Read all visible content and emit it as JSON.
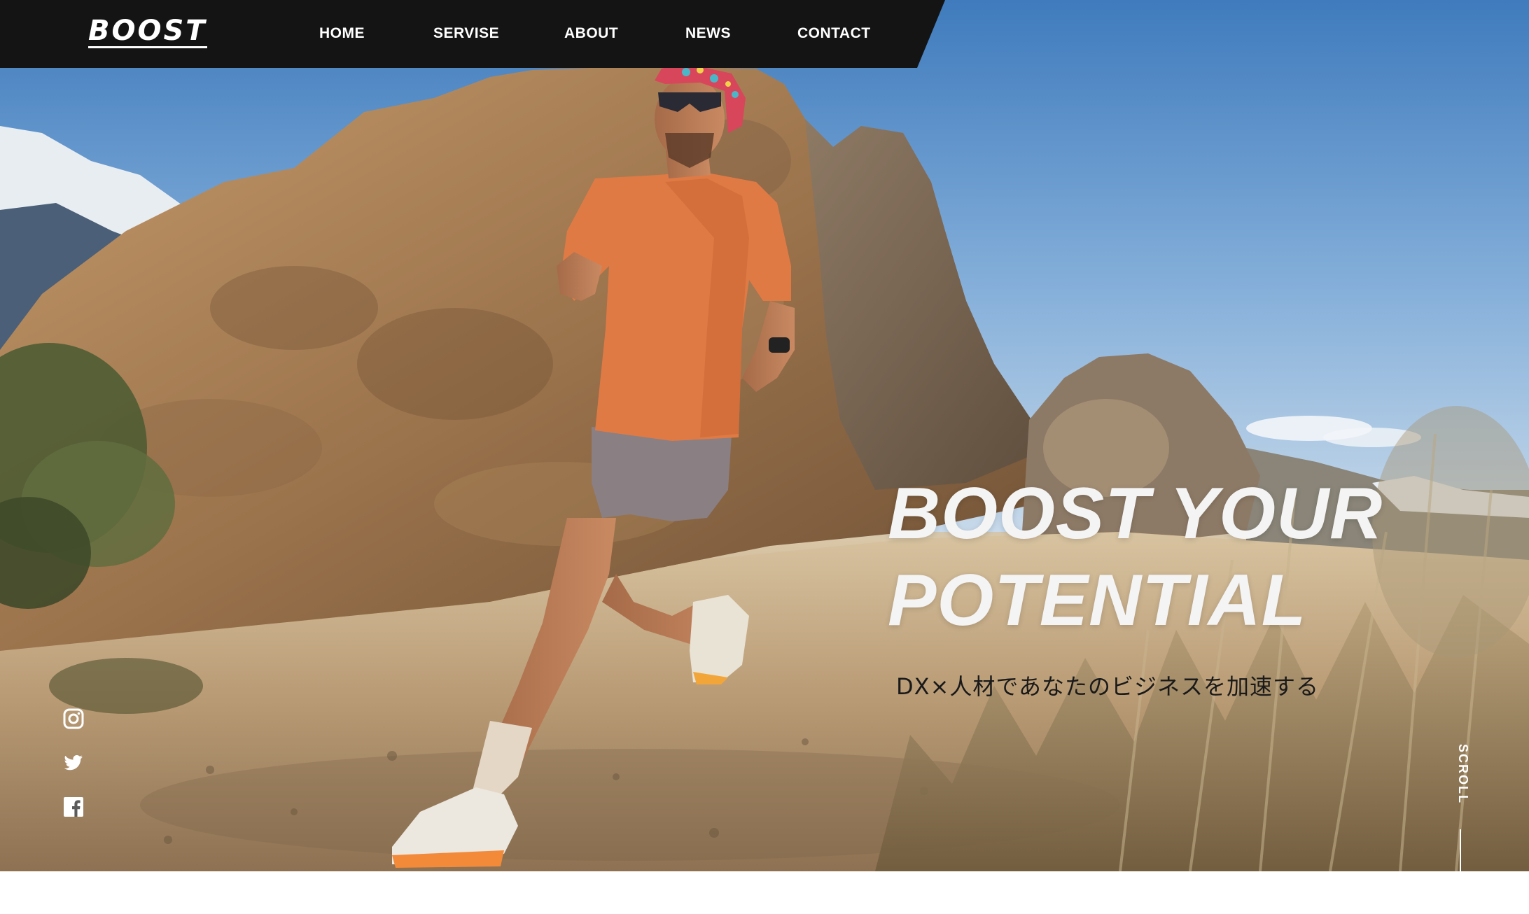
{
  "brand": {
    "logo": "BOOST"
  },
  "nav": {
    "items": [
      {
        "label": "HOME"
      },
      {
        "label": "SERVISE"
      },
      {
        "label": "ABOUT"
      },
      {
        "label": "NEWS"
      },
      {
        "label": "CONTACT"
      }
    ]
  },
  "hero": {
    "headline_line1": "BOOST YOUR",
    "headline_line2": "POTENTIAL",
    "subcopy": "DX×人材であなたのビジネスを加速する",
    "scroll_label": "SCROLL"
  },
  "social": {
    "icons": [
      "instagram-icon",
      "twitter-icon",
      "facebook-icon"
    ]
  },
  "colors": {
    "header_bg": "#141414",
    "text_light": "#ffffff",
    "subcopy": "#1a1a1a",
    "sky": "#5b91c9",
    "shirt": "#e07a45"
  }
}
